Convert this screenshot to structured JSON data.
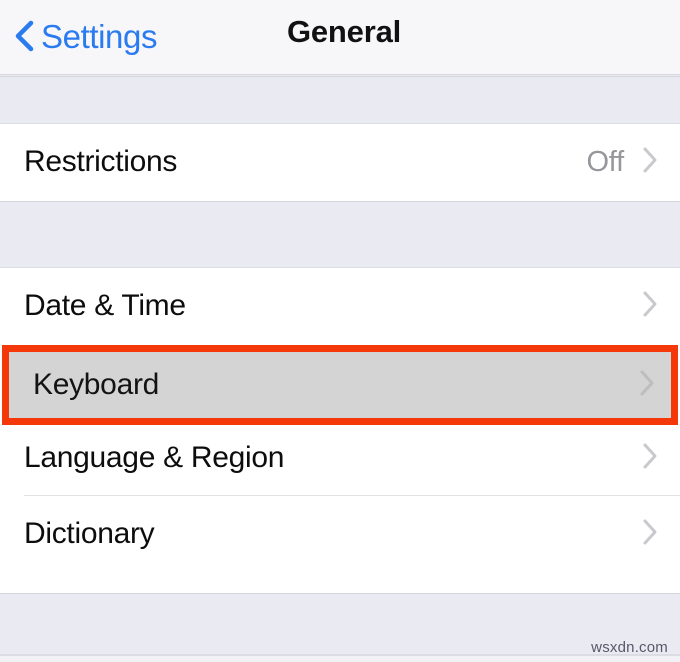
{
  "navbar": {
    "back_label": "Settings",
    "back_icon": "chevron-left-icon",
    "title": "General"
  },
  "colors": {
    "accent_blue": "#2a7bf0",
    "highlight_border": "#f4380a",
    "highlight_fill": "#d4d4d4",
    "group_background": "#eaeaf2",
    "row_background": "#ffffff",
    "value_text": "#96969b"
  },
  "sections": [
    {
      "rows": [
        {
          "label": "Restrictions",
          "value": "Off",
          "accessory": "chevron-right-icon",
          "highlighted": false
        }
      ]
    },
    {
      "rows": [
        {
          "label": "Date & Time",
          "value": "",
          "accessory": "chevron-right-icon",
          "highlighted": false
        },
        {
          "label": "Keyboard",
          "value": "",
          "accessory": "chevron-right-icon",
          "highlighted": true
        },
        {
          "label": "Language & Region",
          "value": "",
          "accessory": "chevron-right-icon",
          "highlighted": false
        },
        {
          "label": "Dictionary",
          "value": "",
          "accessory": "chevron-right-icon",
          "highlighted": false
        }
      ]
    }
  ],
  "watermark": {
    "text": "wsxdn.com"
  }
}
